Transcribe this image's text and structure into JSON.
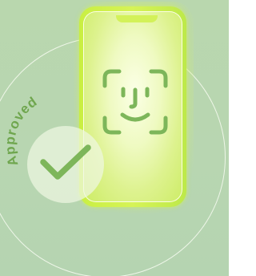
{
  "badge": {
    "label": "Approved",
    "icon": "checkmark-icon"
  },
  "phone": {
    "icon": "face-id-icon"
  },
  "colors": {
    "background": "#b9d7ae",
    "accent_green": "#7db65a",
    "phone_lime": "#d0f055",
    "ring": "#f7fbef"
  }
}
